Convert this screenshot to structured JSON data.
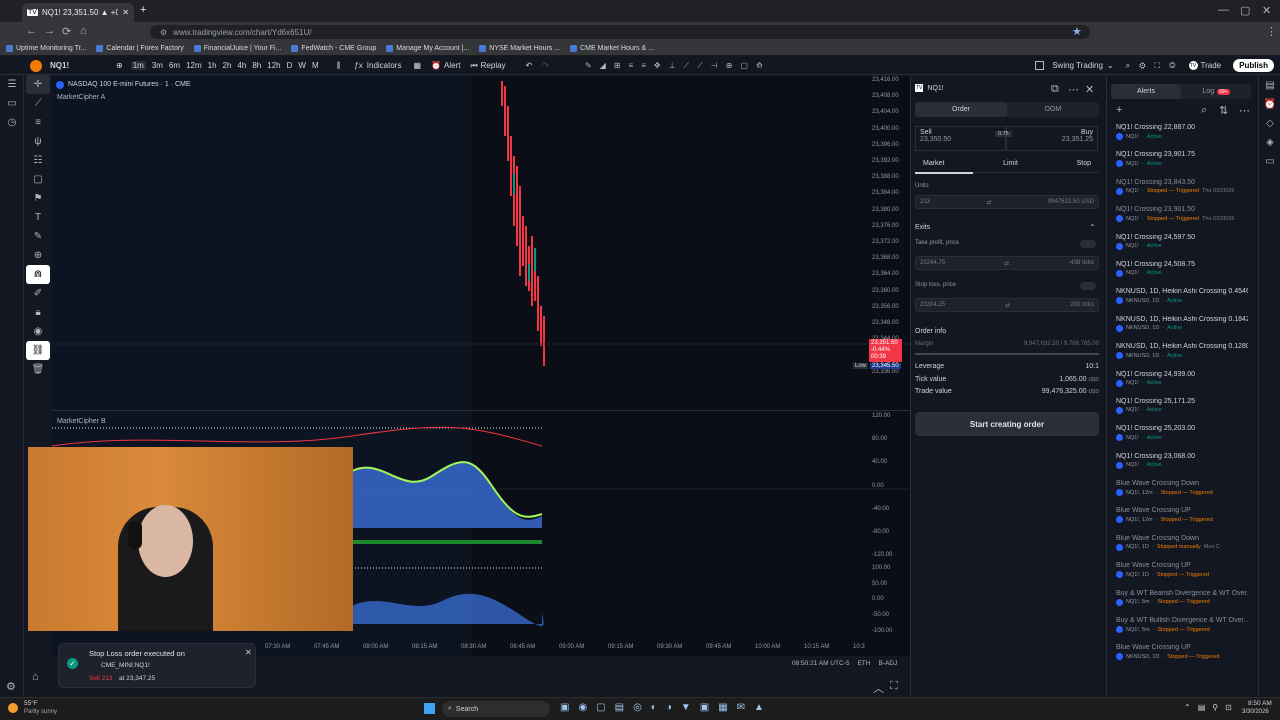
{
  "browser": {
    "tab_title": "NQ1! 23,351.50 ▲ +0.42% Swi",
    "url": "www.tradingview.com/chart/Yd6x651U/",
    "bookmarks": [
      "Uptime Monitoring Tr...",
      "Calendar | Forex Factory",
      "FinancialJuice | Your Fi...",
      "FedWatch - CME Group",
      "Manage My Account |...",
      "NYSE Market Hours ...",
      "CME Market Hours & ..."
    ]
  },
  "toolbar": {
    "symbol": "NQ1!",
    "intervals": [
      "1m",
      "3m",
      "6m",
      "12m",
      "1h",
      "2h",
      "4h",
      "8h",
      "12h",
      "D",
      "W",
      "M"
    ],
    "indicators": "Indicators",
    "alert": "Alert",
    "replay": "Replay",
    "layout_name": "Swing Trading",
    "trade": "Trade",
    "publish": "Publish"
  },
  "chart": {
    "title": "NASDAQ 100 E-mini Futures · 1 · CME",
    "study_a": "MarketCipher A",
    "study_b": "MarketCipher B",
    "price_axis": [
      "23,416.00",
      "23,408.00",
      "23,404.00",
      "23,400.00",
      "23,396.00",
      "23,392.00",
      "23,388.00",
      "23,384.00",
      "23,380.00",
      "23,376.00",
      "23,372.00",
      "23,368.00",
      "23,364.00",
      "23,360.00",
      "23,356.00",
      "23,348.00",
      "23,344.00",
      "23,340.00",
      "23,336.00"
    ],
    "osc_axis": [
      "120.00",
      "80.00",
      "40.00",
      "0.00",
      "-40.00",
      "-80.00",
      "-120.00"
    ],
    "osc2_axis": [
      "100.00",
      "50.00",
      "0.00",
      "-50.00",
      "-100.00"
    ],
    "last_price": "23,351.50",
    "last_change": "-0.44%",
    "last_timer": "00:39",
    "low_label": "Low",
    "low_price": "23,345.50",
    "time_axis": [
      "07:30 AM",
      "07:45 AM",
      "08:00 AM",
      "08:15 AM",
      "08:30 AM",
      "08:45 AM",
      "09:00 AM",
      "09:15 AM",
      "09:30 AM",
      "09:45 AM",
      "10:00 AM",
      "10:15 AM",
      "10:3"
    ],
    "clock": "08:50:21 AM UTC-5",
    "session": "ETH",
    "adj": "B-ADJ"
  },
  "order_panel": {
    "symbol": "NQ1!",
    "tab_order": "Order",
    "tab_dom": "DOM",
    "sell_label": "Sell",
    "sell_price": "23,350.50",
    "spread": "0.75",
    "buy_label": "Buy",
    "buy_price": "23,351.25",
    "types": [
      "Market",
      "Limit",
      "Stop"
    ],
    "units_label": "Units",
    "units_value": "213",
    "units_usd": "9947632.50 USD",
    "exits_label": "Exits",
    "tp_label": "Take profit, price",
    "tp_value": "23244.75",
    "tp_ticks": "-438 ticks",
    "sl_label": "Stop loss, price",
    "sl_value": "23304.25",
    "sl_ticks": "200 ticks",
    "info_label": "Order info",
    "margin_label": "Margin",
    "margin_value": "9,947,632.50 / 9,766,765.00",
    "leverage_label": "Leverage",
    "leverage_value": "10:1",
    "tick_label": "Tick value",
    "tick_value": "1,065.00",
    "trade_label": "Trade value",
    "trade_value": "99,476,325.00",
    "currency": "USD",
    "cta": "Start creating order"
  },
  "alerts_panel": {
    "tab_alerts": "Alerts",
    "tab_log": "Log",
    "log_badge": "99+",
    "items": [
      {
        "title": "NQ1! Crossing 22,887.00",
        "sym": "NQ1!",
        "status": "Active",
        "extra": "",
        "active": true
      },
      {
        "title": "NQ1! Crossing 23,901.75",
        "sym": "NQ1!",
        "status": "Active",
        "extra": "",
        "active": true
      },
      {
        "title": "NQ1! Crossing 23,843.50",
        "sym": "NQ1!",
        "status": "Stopped — Triggered",
        "extra": "Thu 03/26/26",
        "active": false
      },
      {
        "title": "NQ1! Crossing 23,901.50",
        "sym": "NQ1!",
        "status": "Stopped — Triggered",
        "extra": "Thu 03/26/26",
        "active": false
      },
      {
        "title": "NQ1! Crossing 24,597.50",
        "sym": "NQ1!",
        "status": "Active",
        "extra": "",
        "active": true
      },
      {
        "title": "NQ1! Crossing 24,508.75",
        "sym": "NQ1!",
        "status": "Active",
        "extra": "",
        "active": true
      },
      {
        "title": "NKNUSD, 1D, Heikin Ashi Crossing 0.4546",
        "sym": "NKNUSD, 1D",
        "status": "Active",
        "extra": "",
        "active": true
      },
      {
        "title": "NKNUSD, 1D, Heikin Ashi Crossing 0.1842",
        "sym": "NKNUSD, 1D",
        "status": "Active",
        "extra": "",
        "active": true
      },
      {
        "title": "NKNUSD, 1D, Heikin Ashi Crossing 0.1280",
        "sym": "NKNUSD, 1D",
        "status": "Active",
        "extra": "",
        "active": true
      },
      {
        "title": "NQ1! Crossing 24,939.00",
        "sym": "NQ1!",
        "status": "Active",
        "extra": "",
        "active": true
      },
      {
        "title": "NQ1! Crossing 25,171.25",
        "sym": "NQ1!",
        "status": "Active",
        "extra": "",
        "active": true
      },
      {
        "title": "NQ1! Crossing 25,203.00",
        "sym": "NQ1!",
        "status": "Active",
        "extra": "",
        "active": true
      },
      {
        "title": "NQ1! Crossing 23,068.00",
        "sym": "NQ1!",
        "status": "Active",
        "extra": "",
        "active": true
      },
      {
        "title": "Blue Wave Crossing Down",
        "sym": "NQ1!, 12m",
        "status": "Stopped — Triggered",
        "extra": "",
        "active": false
      },
      {
        "title": "Blue Wave Crossing UP",
        "sym": "NQ1!, 12m",
        "status": "Stopped — Triggered",
        "extra": "",
        "active": false
      },
      {
        "title": "Blue Wave Crossing Down",
        "sym": "NQ1!, 1D",
        "status": "Stopped manually",
        "extra": "Mon C",
        "active": false
      },
      {
        "title": "Blue Wave Crossing UP",
        "sym": "NQ1!, 1D",
        "status": "Stopped — Triggered",
        "extra": "",
        "active": false
      },
      {
        "title": "Buy & WT Bearish Divergence & WT Over...",
        "sym": "NQ1!, 5m",
        "status": "Stopped — Triggered",
        "extra": "",
        "active": false
      },
      {
        "title": "Buy & WT Bullish Divergence & WT Over...",
        "sym": "NQ1!, 5m",
        "status": "Stopped — Triggered",
        "extra": "",
        "active": false
      },
      {
        "title": "Blue Wave Crossing UP",
        "sym": "NKNUSD, 1D",
        "status": "Stopped — Triggered",
        "extra": "",
        "active": false
      }
    ]
  },
  "toast": {
    "title": "Stop Loss order executed on",
    "account": "CME_MINI:NQ1!",
    "side": "Sell 213",
    "detail": "at 23,347.25"
  },
  "taskbar": {
    "temp": "55°F",
    "weather": "Partly sunny",
    "search": "Search",
    "time": "8:50 AM",
    "date": "3/30/2026"
  }
}
